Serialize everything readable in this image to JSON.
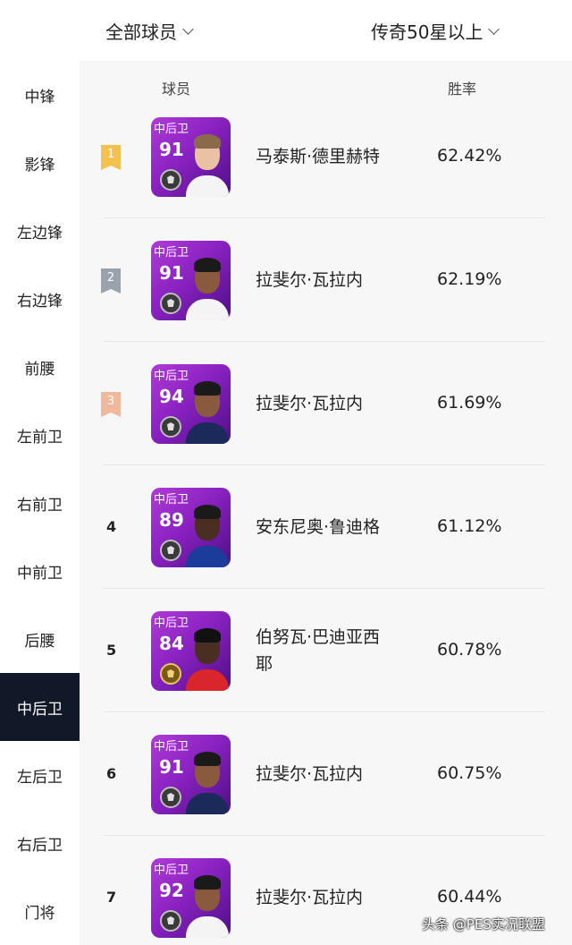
{
  "header": {
    "filter_left": "全部球员",
    "filter_right": "传奇50星以上"
  },
  "sidebar": {
    "items": [
      "中锋",
      "影锋",
      "左边锋",
      "右边锋",
      "前腰",
      "左前卫",
      "右前卫",
      "中前卫",
      "后腰",
      "中后卫",
      "左后卫",
      "右后卫",
      "门将"
    ],
    "active": "中后卫"
  },
  "table": {
    "col_player": "球员",
    "col_rate": "胜率",
    "rows": [
      {
        "rank": "1",
        "position": "中后卫",
        "rating": "91",
        "name": "马泰斯·德里赫特",
        "rate": "62.42%",
        "badge_color": "#f2c14e",
        "skin": "#e9c2a4",
        "hair": "#8a6a4a",
        "shirt": "#f4f4f4",
        "emblem": "silver"
      },
      {
        "rank": "2",
        "position": "中后卫",
        "rating": "91",
        "name": "拉斐尔·瓦拉内",
        "rate": "62.19%",
        "badge_color": "#9aa3ad",
        "skin": "#8a5a3e",
        "hair": "#1a1a1a",
        "shirt": "#f4f4f4",
        "emblem": "silver"
      },
      {
        "rank": "3",
        "position": "中后卫",
        "rating": "94",
        "name": "拉斐尔·瓦拉内",
        "rate": "61.69%",
        "badge_color": "#f0b89c",
        "skin": "#8a5a3e",
        "hair": "#1a1a1a",
        "shirt": "#1b2a5a",
        "emblem": "silver"
      },
      {
        "rank": "4",
        "position": "中后卫",
        "rating": "89",
        "name": "安东尼奥·鲁迪格",
        "rate": "61.12%",
        "badge_color": "",
        "skin": "#4a2e22",
        "hair": "#1a1a1a",
        "shirt": "#1c3c9c",
        "emblem": "silver"
      },
      {
        "rank": "5",
        "position": "中后卫",
        "rating": "84",
        "name": "伯努瓦·巴迪亚西耶",
        "rate": "60.78%",
        "badge_color": "",
        "skin": "#4a2e22",
        "hair": "#111111",
        "shirt": "#d9262c",
        "emblem": "gold"
      },
      {
        "rank": "6",
        "position": "中后卫",
        "rating": "91",
        "name": "拉斐尔·瓦拉内",
        "rate": "60.75%",
        "badge_color": "",
        "skin": "#8a5a3e",
        "hair": "#1a1a1a",
        "shirt": "#1b2a5a",
        "emblem": "silver"
      },
      {
        "rank": "7",
        "position": "中后卫",
        "rating": "92",
        "name": "拉斐尔·瓦拉内",
        "rate": "60.44%",
        "badge_color": "",
        "skin": "#8a5a3e",
        "hair": "#1a1a1a",
        "shirt": "#f4f4f4",
        "emblem": "silver"
      }
    ]
  },
  "watermark": "头条 @PES实况联盟"
}
